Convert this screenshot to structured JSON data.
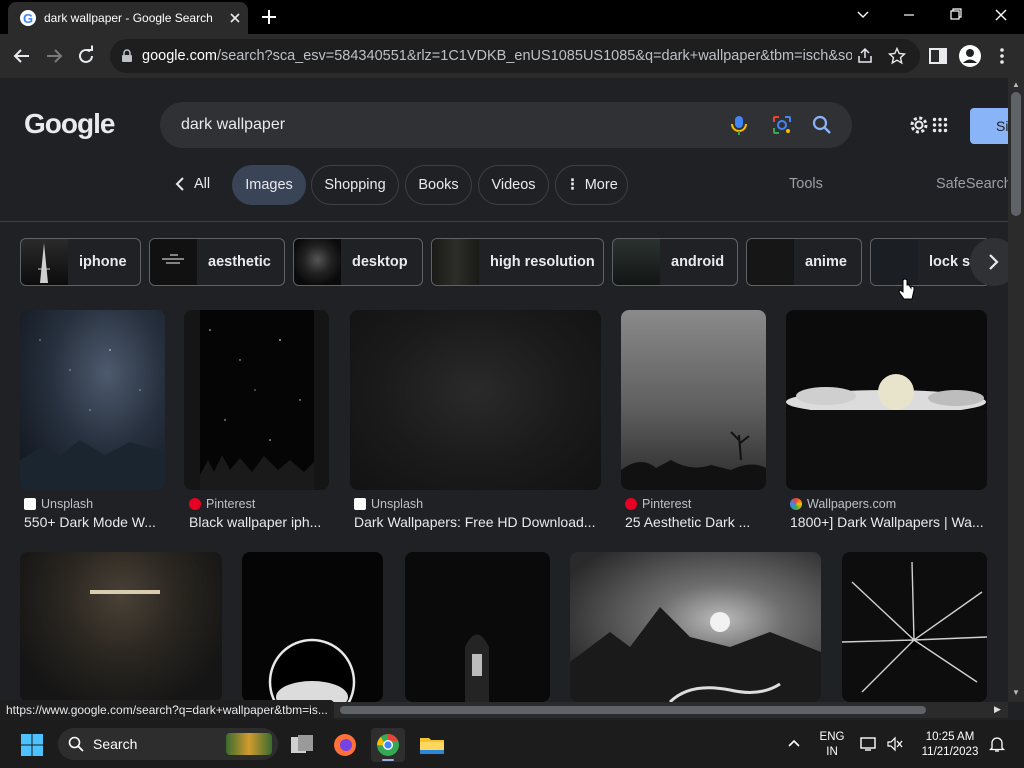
{
  "browser": {
    "tab_title": "dark wallpaper - Google Search",
    "url_host": "google.com",
    "url_path": "/search?sca_esv=584340551&rlz=1C1VDKB_enUS1085US1085&q=dark+wallpaper&tbm=isch&sour..."
  },
  "search": {
    "query": "dark wallpaper"
  },
  "header": {
    "logo": "Google",
    "sign_in": "Si"
  },
  "filters": {
    "all": "All",
    "images": "Images",
    "shopping": "Shopping",
    "books": "Books",
    "videos": "Videos",
    "more": "More",
    "tools": "Tools",
    "safesearch": "SafeSearch"
  },
  "chips": [
    "iphone",
    "aesthetic",
    "desktop",
    "high resolution",
    "android",
    "anime",
    "lock sc"
  ],
  "results_row1": [
    {
      "source": "Unsplash",
      "title": "550+ Dark Mode W..."
    },
    {
      "source": "Pinterest",
      "title": "Black wallpaper iph..."
    },
    {
      "source": "Unsplash",
      "title": "Dark Wallpapers: Free HD Download..."
    },
    {
      "source": "Pinterest",
      "title": "25 Aesthetic Dark ..."
    },
    {
      "source": "Wallpapers.com",
      "title": "1800+] Dark Wallpapers | Wa..."
    }
  ],
  "status_url": "https://www.google.com/search?q=dark+wallpaper&tbm=is...",
  "taskbar": {
    "search": "Search",
    "lang1": "ENG",
    "lang2": "IN",
    "time": "10:25 AM",
    "date": "11/21/2023"
  },
  "colors": {
    "page_bg": "#202124",
    "active_chip": "#394457",
    "accent_blue": "#8ab4f8"
  }
}
